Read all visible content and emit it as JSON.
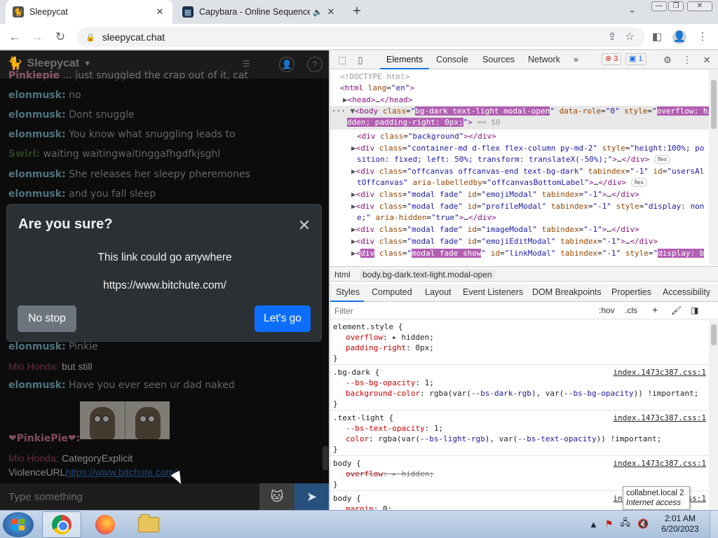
{
  "browser": {
    "tabs": [
      {
        "title": "Sleepycat",
        "favicon": "cat-icon",
        "close": "✕"
      },
      {
        "title": "Capybara - Online Sequence",
        "favicon": "sequencer-icon",
        "audio": "speaker-icon",
        "close": "✕"
      }
    ],
    "new_tab": "+",
    "tab_menu": "⌄",
    "window_controls": {
      "minimize": "—",
      "restore": "❐",
      "close": "✕"
    },
    "url": "sleepycat.chat"
  },
  "chat": {
    "brand": "Sleepycat",
    "messages": [
      {
        "user": "Pinkiepie",
        "text": "... just snuggled the crap out of it, cat",
        "user_class": "u-pinkie"
      },
      {
        "user": "elonmusk:",
        "text": "no",
        "user_class": "u-elon"
      },
      {
        "user": "elonmusk:",
        "text": "Dont snuggle",
        "user_class": "u-elon"
      },
      {
        "user": "elonmusk:",
        "text": "You know what snuggling leads to",
        "user_class": "u-elon"
      },
      {
        "user": "Swirl:",
        "text": "waiting waitingwaitinggafhgdfkjsghl",
        "user_class": "u-swirl"
      },
      {
        "user": "elonmusk:",
        "text": "She releases her sleepy pheremones",
        "user_class": "u-elon"
      },
      {
        "user": "elonmusk:",
        "text": "and you fall sleep",
        "user_class": "u-elon"
      },
      {
        "user": "elonmusk:",
        "text": "Pinkie",
        "user_class": "u-elon"
      },
      {
        "user": "Mio Honda:",
        "text": "but still",
        "user_class": "u-mio"
      },
      {
        "user": "elonmusk:",
        "text": "Have you ever seen ur dad naked",
        "user_class": "u-elon"
      },
      {
        "user": "❤PinkiePie❤:",
        "text": "",
        "user_class": "u-pinkie"
      },
      {
        "user": "Mio Honda:",
        "text": "CategoryExplicit",
        "user_class": "u-mio"
      }
    ],
    "last_line_prefix": "ViolenceURL",
    "last_line_link": "https://www.bitchute.com/",
    "input_placeholder": "Type something",
    "cat_button": "🐱",
    "send_button": "➤"
  },
  "modal": {
    "title": "Are you sure?",
    "text": "This link could go anywhere",
    "url": "https://www.bitchute.com/",
    "cancel": "No stop",
    "confirm": "Let's go",
    "close": "✕"
  },
  "devtools": {
    "tabs": [
      "Elements",
      "Console",
      "Sources",
      "Network",
      "»"
    ],
    "errors": "3",
    "messages": "1",
    "breadcrumbs": [
      "html",
      "body.bg-dark.text-light.modal-open"
    ],
    "styles_tabs": [
      "Styles",
      "Computed",
      "Layout",
      "Event Listeners",
      "DOM Breakpoints",
      "Properties",
      "Accessibility"
    ],
    "filter_placeholder": "Filter",
    "filter_buttons": [
      ":hov",
      ".cls",
      "+"
    ],
    "source_file": "index.1473c387.css:1"
  },
  "tooltip": {
    "title": "collabnet.local  2",
    "subtitle": "Internet access"
  },
  "taskbar": {
    "time": "2:01 AM",
    "date": "6/20/2023"
  },
  "colors": {
    "accent": "#0d6efd",
    "secondary": "#6c757d",
    "modal_bg": "#2b3035",
    "devtools_highlight": "#b25fb2"
  }
}
